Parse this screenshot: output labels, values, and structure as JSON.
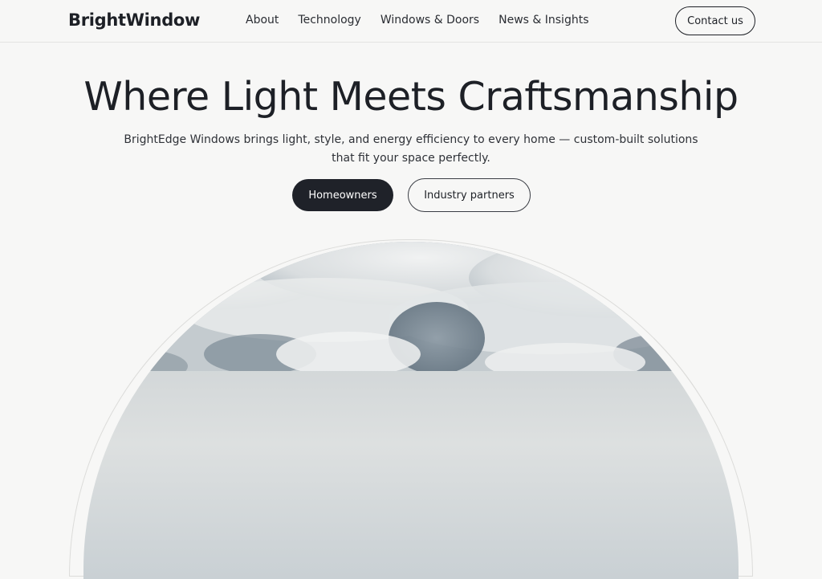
{
  "brand": {
    "name": "BrightWindow"
  },
  "nav": {
    "items": [
      {
        "label": "About"
      },
      {
        "label": "Technology"
      },
      {
        "label": "Windows & Doors"
      },
      {
        "label": "News & Insights"
      }
    ],
    "contact_label": "Contact us"
  },
  "hero": {
    "title": "Where Light Meets Craftsmanship",
    "subtitle": "BrightEdge Windows brings light, style, and energy efficiency to every home — custom-built solutions that fit your space perfectly.",
    "primary_button": "Homeowners",
    "secondary_button": "Industry partners"
  },
  "colors": {
    "text": "#1d2026",
    "background": "#f7f7f6",
    "button_dark": "#1f2229"
  },
  "hero_image": {
    "subject": "cloudy-sky"
  }
}
